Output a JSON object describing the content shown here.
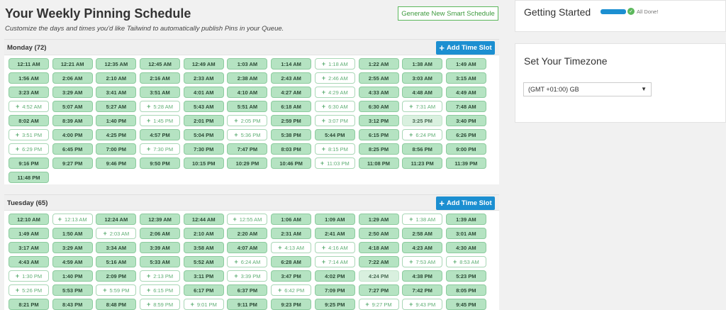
{
  "schedule": {
    "title": "Your Weekly Pinning Schedule",
    "subtitle": "Customize the days and times you'd like Tailwind to automatically publish Pins in your Queue.",
    "generate_label": "Generate New Smart Schedule"
  },
  "days": [
    {
      "title": "Monday (72)",
      "add_label": "Add Time Slot",
      "slots": [
        {
          "t": "12:11 AM",
          "s": "filled"
        },
        {
          "t": "12:21 AM",
          "s": "filled"
        },
        {
          "t": "12:35 AM",
          "s": "filled"
        },
        {
          "t": "12:45 AM",
          "s": "filled"
        },
        {
          "t": "12:49 AM",
          "s": "filled"
        },
        {
          "t": "1:03 AM",
          "s": "filled"
        },
        {
          "t": "1:14 AM",
          "s": "filled"
        },
        {
          "t": "1:18 AM",
          "s": "empty"
        },
        {
          "t": "1:22 AM",
          "s": "filled"
        },
        {
          "t": "1:38 AM",
          "s": "filled"
        },
        {
          "t": "1:49 AM",
          "s": "filled"
        },
        {
          "t": "1:56 AM",
          "s": "filled"
        },
        {
          "t": "2:06 AM",
          "s": "filled"
        },
        {
          "t": "2:10 AM",
          "s": "filled"
        },
        {
          "t": "2:16 AM",
          "s": "filled"
        },
        {
          "t": "2:33 AM",
          "s": "filled"
        },
        {
          "t": "2:38 AM",
          "s": "filled"
        },
        {
          "t": "2:43 AM",
          "s": "filled"
        },
        {
          "t": "2:46 AM",
          "s": "empty"
        },
        {
          "t": "2:55 AM",
          "s": "filled"
        },
        {
          "t": "3:03 AM",
          "s": "filled"
        },
        {
          "t": "3:15 AM",
          "s": "filled"
        },
        {
          "t": "3:23 AM",
          "s": "filled"
        },
        {
          "t": "3:29 AM",
          "s": "filled"
        },
        {
          "t": "3:41 AM",
          "s": "filled"
        },
        {
          "t": "3:51 AM",
          "s": "filled"
        },
        {
          "t": "4:01 AM",
          "s": "filled"
        },
        {
          "t": "4:10 AM",
          "s": "filled"
        },
        {
          "t": "4:27 AM",
          "s": "filled"
        },
        {
          "t": "4:29 AM",
          "s": "empty"
        },
        {
          "t": "4:33 AM",
          "s": "filled"
        },
        {
          "t": "4:48 AM",
          "s": "filled"
        },
        {
          "t": "4:49 AM",
          "s": "filled"
        },
        {
          "t": "4:52 AM",
          "s": "empty"
        },
        {
          "t": "5:07 AM",
          "s": "filled"
        },
        {
          "t": "5:27 AM",
          "s": "filled"
        },
        {
          "t": "5:28 AM",
          "s": "empty"
        },
        {
          "t": "5:43 AM",
          "s": "filled"
        },
        {
          "t": "5:51 AM",
          "s": "filled"
        },
        {
          "t": "6:18 AM",
          "s": "filled"
        },
        {
          "t": "6:30 AM",
          "s": "empty"
        },
        {
          "t": "6:30 AM",
          "s": "filled"
        },
        {
          "t": "7:31 AM",
          "s": "empty"
        },
        {
          "t": "7:48 AM",
          "s": "filled"
        },
        {
          "t": "8:02 AM",
          "s": "filled"
        },
        {
          "t": "8:39 AM",
          "s": "filled"
        },
        {
          "t": "1:40 PM",
          "s": "filled"
        },
        {
          "t": "1:45 PM",
          "s": "empty"
        },
        {
          "t": "2:01 PM",
          "s": "filled"
        },
        {
          "t": "2:05 PM",
          "s": "empty"
        },
        {
          "t": "2:59 PM",
          "s": "filled"
        },
        {
          "t": "3:07 PM",
          "s": "empty"
        },
        {
          "t": "3:12 PM",
          "s": "filled"
        },
        {
          "t": "3:25 PM",
          "s": "pale"
        },
        {
          "t": "3:40 PM",
          "s": "filled"
        },
        {
          "t": "3:51 PM",
          "s": "empty"
        },
        {
          "t": "4:00 PM",
          "s": "filled"
        },
        {
          "t": "4:25 PM",
          "s": "filled"
        },
        {
          "t": "4:57 PM",
          "s": "filled"
        },
        {
          "t": "5:04 PM",
          "s": "filled"
        },
        {
          "t": "5:36 PM",
          "s": "empty"
        },
        {
          "t": "5:38 PM",
          "s": "filled"
        },
        {
          "t": "5:44 PM",
          "s": "filled"
        },
        {
          "t": "6:15 PM",
          "s": "filled"
        },
        {
          "t": "6:24 PM",
          "s": "empty"
        },
        {
          "t": "6:26 PM",
          "s": "filled"
        },
        {
          "t": "6:29 PM",
          "s": "empty"
        },
        {
          "t": "6:45 PM",
          "s": "filled"
        },
        {
          "t": "7:00 PM",
          "s": "filled"
        },
        {
          "t": "7:30 PM",
          "s": "empty"
        },
        {
          "t": "7:30 PM",
          "s": "filled"
        },
        {
          "t": "7:47 PM",
          "s": "filled"
        },
        {
          "t": "8:03 PM",
          "s": "filled"
        },
        {
          "t": "8:15 PM",
          "s": "empty"
        },
        {
          "t": "8:25 PM",
          "s": "filled"
        },
        {
          "t": "8:56 PM",
          "s": "filled"
        },
        {
          "t": "9:00 PM",
          "s": "filled"
        },
        {
          "t": "9:16 PM",
          "s": "filled"
        },
        {
          "t": "9:27 PM",
          "s": "filled"
        },
        {
          "t": "9:46 PM",
          "s": "filled"
        },
        {
          "t": "9:50 PM",
          "s": "filled"
        },
        {
          "t": "10:15 PM",
          "s": "filled"
        },
        {
          "t": "10:29 PM",
          "s": "filled"
        },
        {
          "t": "10:46 PM",
          "s": "filled"
        },
        {
          "t": "11:03 PM",
          "s": "empty"
        },
        {
          "t": "11:08 PM",
          "s": "filled"
        },
        {
          "t": "11:23 PM",
          "s": "filled"
        },
        {
          "t": "11:39 PM",
          "s": "filled"
        },
        {
          "t": "11:48 PM",
          "s": "filled"
        }
      ]
    },
    {
      "title": "Tuesday (65)",
      "add_label": "Add Time Slot",
      "slots": [
        {
          "t": "12:10 AM",
          "s": "filled"
        },
        {
          "t": "12:13 AM",
          "s": "empty"
        },
        {
          "t": "12:24 AM",
          "s": "filled"
        },
        {
          "t": "12:39 AM",
          "s": "filled"
        },
        {
          "t": "12:44 AM",
          "s": "filled"
        },
        {
          "t": "12:55 AM",
          "s": "empty"
        },
        {
          "t": "1:06 AM",
          "s": "filled"
        },
        {
          "t": "1:09 AM",
          "s": "filled"
        },
        {
          "t": "1:29 AM",
          "s": "filled"
        },
        {
          "t": "1:38 AM",
          "s": "empty"
        },
        {
          "t": "1:39 AM",
          "s": "filled"
        },
        {
          "t": "1:49 AM",
          "s": "filled"
        },
        {
          "t": "1:50 AM",
          "s": "filled"
        },
        {
          "t": "2:03 AM",
          "s": "empty"
        },
        {
          "t": "2:06 AM",
          "s": "filled"
        },
        {
          "t": "2:10 AM",
          "s": "filled"
        },
        {
          "t": "2:20 AM",
          "s": "filled"
        },
        {
          "t": "2:31 AM",
          "s": "filled"
        },
        {
          "t": "2:41 AM",
          "s": "filled"
        },
        {
          "t": "2:50 AM",
          "s": "filled"
        },
        {
          "t": "2:58 AM",
          "s": "filled"
        },
        {
          "t": "3:01 AM",
          "s": "filled"
        },
        {
          "t": "3:17 AM",
          "s": "filled"
        },
        {
          "t": "3:29 AM",
          "s": "filled"
        },
        {
          "t": "3:34 AM",
          "s": "filled"
        },
        {
          "t": "3:39 AM",
          "s": "filled"
        },
        {
          "t": "3:58 AM",
          "s": "filled"
        },
        {
          "t": "4:07 AM",
          "s": "filled"
        },
        {
          "t": "4:13 AM",
          "s": "empty"
        },
        {
          "t": "4:16 AM",
          "s": "empty"
        },
        {
          "t": "4:18 AM",
          "s": "filled"
        },
        {
          "t": "4:23 AM",
          "s": "filled"
        },
        {
          "t": "4:30 AM",
          "s": "filled"
        },
        {
          "t": "4:43 AM",
          "s": "filled"
        },
        {
          "t": "4:59 AM",
          "s": "filled"
        },
        {
          "t": "5:16 AM",
          "s": "filled"
        },
        {
          "t": "5:33 AM",
          "s": "filled"
        },
        {
          "t": "5:52 AM",
          "s": "filled"
        },
        {
          "t": "6:24 AM",
          "s": "empty"
        },
        {
          "t": "6:28 AM",
          "s": "filled"
        },
        {
          "t": "7:14 AM",
          "s": "empty"
        },
        {
          "t": "7:22 AM",
          "s": "filled"
        },
        {
          "t": "7:53 AM",
          "s": "empty"
        },
        {
          "t": "8:53 AM",
          "s": "empty"
        },
        {
          "t": "1:30 PM",
          "s": "empty"
        },
        {
          "t": "1:40 PM",
          "s": "filled"
        },
        {
          "t": "2:09 PM",
          "s": "filled"
        },
        {
          "t": "2:13 PM",
          "s": "empty"
        },
        {
          "t": "3:11 PM",
          "s": "filled"
        },
        {
          "t": "3:39 PM",
          "s": "empty"
        },
        {
          "t": "3:47 PM",
          "s": "filled"
        },
        {
          "t": "4:02 PM",
          "s": "filled"
        },
        {
          "t": "4:24 PM",
          "s": "pale"
        },
        {
          "t": "4:38 PM",
          "s": "filled"
        },
        {
          "t": "5:23 PM",
          "s": "filled"
        },
        {
          "t": "5:26 PM",
          "s": "empty"
        },
        {
          "t": "5:53 PM",
          "s": "filled"
        },
        {
          "t": "5:59 PM",
          "s": "empty"
        },
        {
          "t": "6:15 PM",
          "s": "empty"
        },
        {
          "t": "6:17 PM",
          "s": "filled"
        },
        {
          "t": "6:37 PM",
          "s": "filled"
        },
        {
          "t": "6:42 PM",
          "s": "empty"
        },
        {
          "t": "7:09 PM",
          "s": "filled"
        },
        {
          "t": "7:27 PM",
          "s": "filled"
        },
        {
          "t": "7:42 PM",
          "s": "filled"
        },
        {
          "t": "8:05 PM",
          "s": "filled"
        },
        {
          "t": "8:21 PM",
          "s": "filled"
        },
        {
          "t": "8:43 PM",
          "s": "filled"
        },
        {
          "t": "8:48 PM",
          "s": "filled"
        },
        {
          "t": "8:59 PM",
          "s": "empty"
        },
        {
          "t": "9:01 PM",
          "s": "empty"
        },
        {
          "t": "9:11 PM",
          "s": "filled"
        },
        {
          "t": "9:23 PM",
          "s": "filled"
        },
        {
          "t": "9:25 PM",
          "s": "filled"
        },
        {
          "t": "9:27 PM",
          "s": "empty"
        },
        {
          "t": "9:43 PM",
          "s": "empty"
        },
        {
          "t": "9:45 PM",
          "s": "filled"
        }
      ]
    }
  ],
  "getting_started": {
    "title": "Getting Started",
    "done_label": "All Done!",
    "progress": 1.0
  },
  "timezone": {
    "title": "Set Your Timezone",
    "selected": "(GMT +01:00) GB"
  },
  "colors": {
    "accent_blue": "#1c8fd1",
    "slot_green": "#b5e3c2",
    "success_green": "#5cb85c"
  }
}
